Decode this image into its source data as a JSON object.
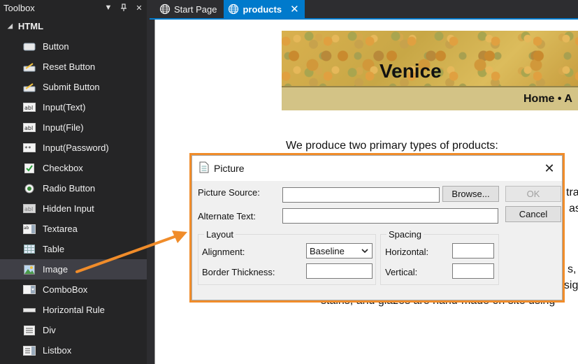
{
  "toolbox": {
    "title": "Toolbox",
    "group": "HTML",
    "items": [
      {
        "label": "Button",
        "icon": "button-icon"
      },
      {
        "label": "Reset Button",
        "icon": "reset-button-icon"
      },
      {
        "label": "Submit Button",
        "icon": "submit-button-icon"
      },
      {
        "label": "Input(Text)",
        "icon": "input-text-icon"
      },
      {
        "label": "Input(File)",
        "icon": "input-file-icon"
      },
      {
        "label": "Input(Password)",
        "icon": "input-password-icon"
      },
      {
        "label": "Checkbox",
        "icon": "checkbox-icon"
      },
      {
        "label": "Radio Button",
        "icon": "radio-button-icon"
      },
      {
        "label": "Hidden Input",
        "icon": "hidden-input-icon"
      },
      {
        "label": "Textarea",
        "icon": "textarea-icon"
      },
      {
        "label": "Table",
        "icon": "table-icon"
      },
      {
        "label": "Image",
        "icon": "image-icon",
        "selected": true
      },
      {
        "label": "ComboBox",
        "icon": "combobox-icon"
      },
      {
        "label": "Horizontal Rule",
        "icon": "horizontal-rule-icon"
      },
      {
        "label": "Div",
        "icon": "div-icon"
      },
      {
        "label": "Listbox",
        "icon": "listbox-icon"
      }
    ]
  },
  "tabs": [
    {
      "label": "Start Page",
      "active": false
    },
    {
      "label": "products",
      "active": true
    }
  ],
  "preview": {
    "banner_title": "Venice",
    "nav": "Home • A",
    "intro": "We produce two primary types of products:",
    "partial_1": "tra",
    "partial_2": "as",
    "partial_3": "s,",
    "partial_4": "esig",
    "partial_5": "stains, and glazes are hand-made on site using"
  },
  "dialog": {
    "title": "Picture",
    "picture_source_label": "Picture Source:",
    "picture_source_value": "",
    "browse_label": "Browse...",
    "ok_label": "OK",
    "cancel_label": "Cancel",
    "alternate_text_label": "Alternate Text:",
    "alternate_text_value": "",
    "layout": {
      "title": "Layout",
      "alignment_label": "Alignment:",
      "alignment_value": "Baseline",
      "border_label": "Border Thickness:",
      "border_value": ""
    },
    "spacing": {
      "title": "Spacing",
      "horizontal_label": "Horizontal:",
      "horizontal_value": "",
      "vertical_label": "Vertical:",
      "vertical_value": ""
    }
  },
  "colors": {
    "accent": "#007acc",
    "highlight": "#f08c2a",
    "toolbox_bg": "#252526"
  }
}
